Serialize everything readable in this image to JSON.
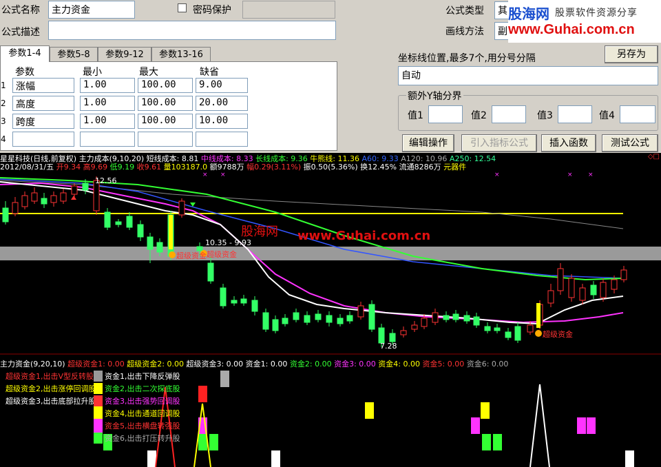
{
  "form": {
    "name_label": "公式名称",
    "name_value": "主力资金",
    "password_label": "密码保护",
    "password_checked": false,
    "desc_label": "公式描述",
    "desc_value": "",
    "type_label": "公式类型",
    "type_value": "其",
    "draw_label": "画线方法",
    "draw_value": "副",
    "save_as_button": "另存为"
  },
  "watermark": {
    "logo": "股海网",
    "tagline": "股票软件资源分享",
    "url": "www.Guhai.com.cn",
    "chart_logo": "股海网",
    "chart_url": "www.Guhai.com.cn"
  },
  "tabs": [
    "参数1-4",
    "参数5-8",
    "参数9-12",
    "参数13-16"
  ],
  "params": {
    "headers": [
      "参数",
      "最小",
      "最大",
      "缺省"
    ],
    "rows": [
      {
        "num": "1",
        "name": "涨幅",
        "min": "1.00",
        "max": "100.00",
        "def": "9.00"
      },
      {
        "num": "2",
        "name": "高度",
        "min": "1.00",
        "max": "100.00",
        "def": "20.00"
      },
      {
        "num": "3",
        "name": "跨度",
        "min": "1.00",
        "max": "100.00",
        "def": "10.00"
      },
      {
        "num": "4",
        "name": "",
        "min": "",
        "max": "",
        "def": ""
      }
    ]
  },
  "axis": {
    "coord_label": "坐标线位置,最多7个,用分号分隔",
    "coord_value": "自动",
    "extra_label": "额外Y轴分界",
    "val_labels": [
      "值1",
      "值2",
      "值3",
      "值4"
    ]
  },
  "buttons": {
    "edit": "编辑操作",
    "import": "引入指标公式",
    "insert": "插入函数",
    "test": "测试公式"
  },
  "chart": {
    "main_title": "星星科技(日线,前复权)",
    "ma_items": [
      {
        "text": "主力成本(9,10,20)",
        "color": "#ffffff"
      },
      {
        "text": "短线成本: 8.81",
        "color": "#ffffff"
      },
      {
        "text": "中线成本: 8.33",
        "color": "#ff33ff"
      },
      {
        "text": "长线成本: 9.36",
        "color": "#33ff33"
      },
      {
        "text": "牛熊线: 11.36",
        "color": "#ffff00"
      },
      {
        "text": "A60: 9.33",
        "color": "#3366ff"
      },
      {
        "text": "A120: 10.96",
        "color": "#aaaaaa"
      },
      {
        "text": "A250: 12.54",
        "color": "#33ff99"
      }
    ],
    "info_date": "2012/08/31/五",
    "info_items": [
      {
        "text": "开9.34",
        "color": "#ff3333"
      },
      {
        "text": "高9.69",
        "color": "#ff3333"
      },
      {
        "text": "低9.19",
        "color": "#33ff33"
      },
      {
        "text": "收9.61",
        "color": "#ff3333"
      },
      {
        "text": "量103187.0",
        "color": "#ffff00"
      },
      {
        "text": "额9788万",
        "color": "#ffffff"
      },
      {
        "text": "幅0.29(3.11%)",
        "color": "#ff3333"
      },
      {
        "text": "振0.50(5.36%)",
        "color": "#ffffff"
      },
      {
        "text": "换12.45%",
        "color": "#ffffff"
      },
      {
        "text": "流通8286万",
        "color": "#ffffff"
      },
      {
        "text": "元器件",
        "color": "#ffff00"
      }
    ],
    "label_high": "12.56",
    "label_range": "10.35 - 9.93",
    "label_low": "7.28",
    "signal_labels": [
      "超级资金",
      "超级资金",
      "超级资金"
    ],
    "sub_title": "主力资金(9,20,10)",
    "sub_items": [
      {
        "text": "超级资金1: 0.00",
        "color": "#ff3333"
      },
      {
        "text": "超级资金2: 0.00",
        "color": "#ffff00"
      },
      {
        "text": "超级资金3: 0.00",
        "color": "#ffffff"
      },
      {
        "text": "资金1: 0.00",
        "color": "#ffffff"
      },
      {
        "text": "资金2: 0.00",
        "color": "#33ff33"
      },
      {
        "text": "资金3: 0.00",
        "color": "#ff33ff"
      },
      {
        "text": "资金4: 0.00",
        "color": "#ffff00"
      },
      {
        "text": "资金5: 0.00",
        "color": "#ff3333"
      },
      {
        "text": "资金6: 0.00",
        "color": "#aaaaaa"
      }
    ],
    "legend_left": [
      {
        "text": "超级资金1,出击V型反转股",
        "color": "#ff3333"
      },
      {
        "text": "超级资金2,出击涨停回调股",
        "color": "#ffff00"
      },
      {
        "text": "超级资金3,出击底部拉升股",
        "color": "#ffffff"
      }
    ],
    "legend_right": [
      {
        "text": "资金1,出击下降反弹股",
        "color": "#ffffff",
        "box": "#999999"
      },
      {
        "text": "资金2,出击二次探底股",
        "color": "#33ff33",
        "box": "#ffff00"
      },
      {
        "text": "资金3,出击强势回调股",
        "color": "#ff33ff",
        "box": "#ff3333"
      },
      {
        "text": "资金4,出击通道回调股",
        "color": "#ffff00",
        "box": "#ffff00"
      },
      {
        "text": "资金5,出击横盘转强股",
        "color": "#ff3333",
        "box": "#ff33ff"
      },
      {
        "text": "资金6,出击打压转升股",
        "color": "#aaaaaa",
        "box": "#33ff33"
      }
    ]
  }
}
